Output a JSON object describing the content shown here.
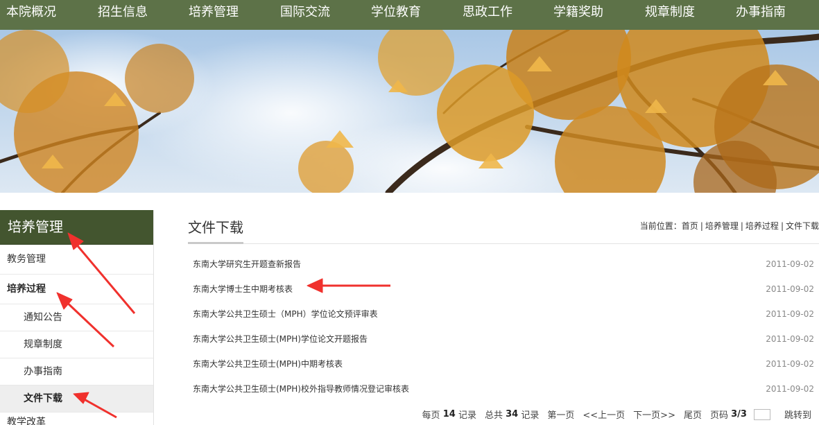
{
  "topnav": {
    "items": [
      "本院概况",
      "招生信息",
      "培养管理",
      "国际交流",
      "学位教育",
      "思政工作",
      "学籍奖助",
      "规章制度",
      "办事指南"
    ]
  },
  "sidebar": {
    "title": "培养管理",
    "items": [
      {
        "label": "教务管理"
      },
      {
        "label": "培养过程"
      },
      {
        "label": "通知公告"
      },
      {
        "label": "规章制度"
      },
      {
        "label": "办事指南"
      },
      {
        "label": "文件下载"
      },
      {
        "label": "教学改革"
      }
    ]
  },
  "content": {
    "title": "文件下载",
    "breadcrumb": {
      "prefix": "当前位置：",
      "items": [
        "首页",
        "培养管理",
        "培养过程",
        "文件下载"
      ],
      "separator": "|"
    },
    "files": [
      {
        "name": "东南大学研究生开题查新报告",
        "date": "2011-09-02"
      },
      {
        "name": "东南大学博士生中期考核表",
        "date": "2011-09-02"
      },
      {
        "name": "东南大学公共卫生硕士（MPH）学位论文预评审表",
        "date": "2011-09-02"
      },
      {
        "name": "东南大学公共卫生硕士(MPH)学位论文开题报告",
        "date": "2011-09-02"
      },
      {
        "name": "东南大学公共卫生硕士(MPH)中期考核表",
        "date": "2011-09-02"
      },
      {
        "name": "东南大学公共卫生硕士(MPH)校外指导教师情况登记审核表",
        "date": "2011-09-02"
      }
    ],
    "pager": {
      "per_page_label": "每页",
      "per_page": "14",
      "records_unit": "记录",
      "total_label": "总共",
      "total": "34",
      "first": "第一页",
      "prev": "<<上一页",
      "next": "下一页>>",
      "last": "尾页",
      "page_label": "页码",
      "page_value": "3/3",
      "jump_input": "",
      "jump": "跳转到"
    }
  },
  "colors": {
    "nav_bg": "#5d7248",
    "sidebar_title_bg": "#43552f",
    "annotation_red": "#f0312d"
  }
}
